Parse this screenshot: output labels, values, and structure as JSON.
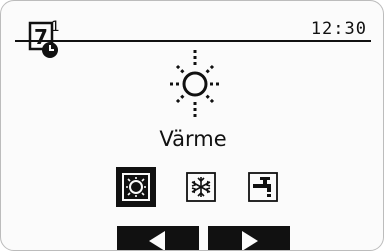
{
  "header": {
    "screen_number": "7",
    "superscript": "1",
    "time": "12:30"
  },
  "main": {
    "mode_label": "Värme",
    "mode_icon": "sun-icon"
  },
  "mode_buttons": [
    {
      "name": "heat",
      "icon": "heating-icon",
      "selected": true
    },
    {
      "name": "cool",
      "icon": "snowflake-icon",
      "selected": false
    },
    {
      "name": "dhw",
      "icon": "faucet-icon",
      "selected": false
    }
  ],
  "nav": {
    "left_icon": "arrow-left-icon",
    "right_icon": "arrow-right-icon"
  },
  "colors": {
    "ink": "#111111",
    "background": "#fbfbfb"
  }
}
